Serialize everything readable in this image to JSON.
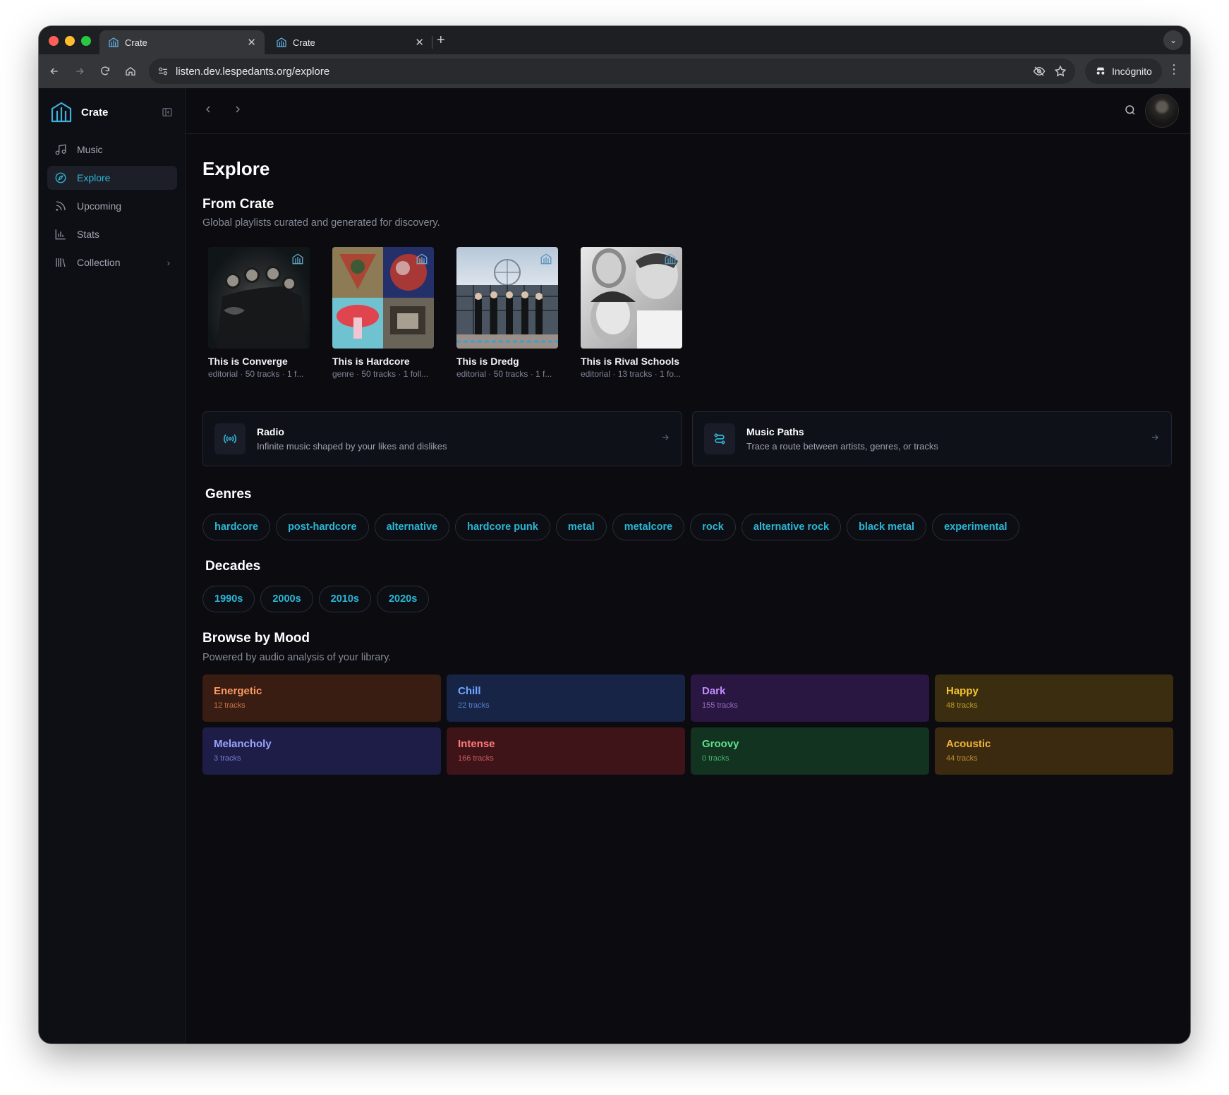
{
  "browser": {
    "tabs": [
      {
        "title": "Crate",
        "active": true
      },
      {
        "title": "Crate",
        "active": false
      }
    ],
    "url": "listen.dev.lespedants.org/explore",
    "incognito_label": "Incógnito"
  },
  "sidebar": {
    "brand": "Crate",
    "items": [
      {
        "label": "Music",
        "icon": "music-note-icon"
      },
      {
        "label": "Explore",
        "icon": "compass-icon",
        "active": true
      },
      {
        "label": "Upcoming",
        "icon": "rss-icon"
      },
      {
        "label": "Stats",
        "icon": "bar-chart-icon"
      },
      {
        "label": "Collection",
        "icon": "library-icon",
        "has_chevron": true
      }
    ]
  },
  "page": {
    "title": "Explore",
    "from_crate": {
      "title": "From Crate",
      "subtitle": "Global playlists curated and generated for discovery.",
      "playlists": [
        {
          "title": "This is Converge",
          "meta": "editorial · 50 tracks · 1 f..."
        },
        {
          "title": "This is Hardcore",
          "meta": "genre · 50 tracks · 1 foll..."
        },
        {
          "title": "This is Dredg",
          "meta": "editorial · 50 tracks · 1 f..."
        },
        {
          "title": "This is Rival Schools",
          "meta": "editorial · 13 tracks · 1 fo..."
        }
      ]
    },
    "features": [
      {
        "title": "Radio",
        "description": "Infinite music shaped by your likes and dislikes",
        "icon": "radio-icon"
      },
      {
        "title": "Music Paths",
        "description": "Trace a route between artists, genres, or tracks",
        "icon": "route-icon"
      }
    ],
    "genres": {
      "title": "Genres",
      "items": [
        "hardcore",
        "post-hardcore",
        "alternative",
        "hardcore punk",
        "metal",
        "metalcore",
        "rock",
        "alternative rock",
        "black metal",
        "experimental"
      ]
    },
    "decades": {
      "title": "Decades",
      "items": [
        "1990s",
        "2000s",
        "2010s",
        "2020s"
      ]
    },
    "moods": {
      "title": "Browse by Mood",
      "subtitle": "Powered by audio analysis of your library.",
      "items": [
        {
          "name": "Energetic",
          "count": "12 tracks",
          "bg": "#3a1d12",
          "fg": "#fb9a63"
        },
        {
          "name": "Chill",
          "count": "22 tracks",
          "bg": "#172446",
          "fg": "#6ea8ff"
        },
        {
          "name": "Dark",
          "count": "155 tracks",
          "bg": "#2a1741",
          "fg": "#c08cff"
        },
        {
          "name": "Happy",
          "count": "48 tracks",
          "bg": "#3b2d10",
          "fg": "#f5c531"
        },
        {
          "name": "Melancholy",
          "count": "3 tracks",
          "bg": "#1d1d48",
          "fg": "#9aa4ff"
        },
        {
          "name": "Intense",
          "count": "166 tracks",
          "bg": "#3f1418",
          "fg": "#ff7a7a"
        },
        {
          "name": "Groovy",
          "count": "0 tracks",
          "bg": "#123320",
          "fg": "#5fe08c"
        },
        {
          "name": "Acoustic",
          "count": "44 tracks",
          "bg": "#3b2a10",
          "fg": "#f0b23a"
        }
      ]
    }
  },
  "colors": {
    "accent": "#2bb6d6",
    "background": "#0b0b10"
  }
}
